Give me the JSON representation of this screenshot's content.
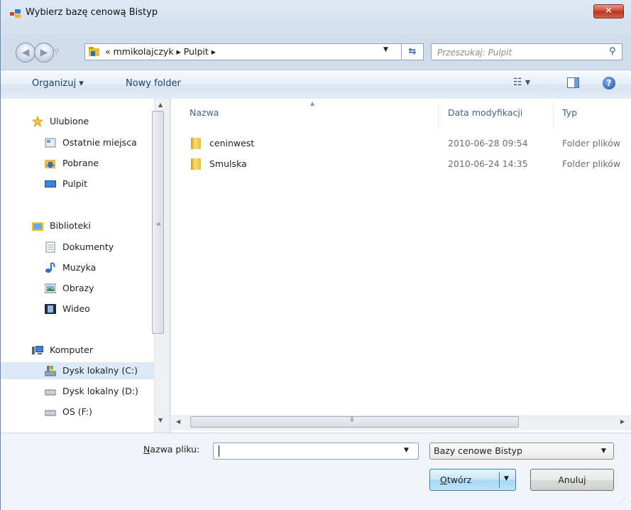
{
  "window": {
    "title": "Wybierz bazę cenową Bistyp",
    "close_label": "✕"
  },
  "address": {
    "path": "« mmikolajczyk ▸ Pulpit ▸",
    "search_placeholder": "Przeszukaj: Pulpit"
  },
  "toolbar": {
    "organize_label": "Organizuj ▾",
    "new_folder_label": "Nowy folder",
    "view_label": "☷ ▾",
    "help_label": "?"
  },
  "nav": {
    "favorites": {
      "header": "Ulubione",
      "items": [
        "Ostatnie miejsca",
        "Pobrane",
        "Pulpit"
      ]
    },
    "libraries": {
      "header": "Biblioteki",
      "items": [
        "Dokumenty",
        "Muzyka",
        "Obrazy",
        "Wideo"
      ]
    },
    "computer": {
      "header": "Komputer",
      "items": [
        "Dysk lokalny (C:)",
        "Dysk lokalny (D:)",
        "OS (F:)"
      ]
    }
  },
  "file_list": {
    "columns": [
      "Nazwa",
      "Data modyfikacji",
      "Typ"
    ],
    "rows": [
      {
        "name": "ceninwest",
        "date": "2010-06-28 09:54",
        "type": "Folder plików"
      },
      {
        "name": "Smulska",
        "date": "2010-06-24 14:35",
        "type": "Folder plików"
      }
    ]
  },
  "footer": {
    "filename_label_underlined": "N",
    "filename_label_rest": "azwa pliku:",
    "filename_value": "",
    "filter_value": "Bazy cenowe Bistyp",
    "open_label_underlined": "O",
    "open_label_rest": "twórz",
    "cancel_label": "Anuluj"
  },
  "colors": {
    "accent": "#3c7fb1",
    "selection": "#dde9f6",
    "close_red": "#c8442f"
  }
}
